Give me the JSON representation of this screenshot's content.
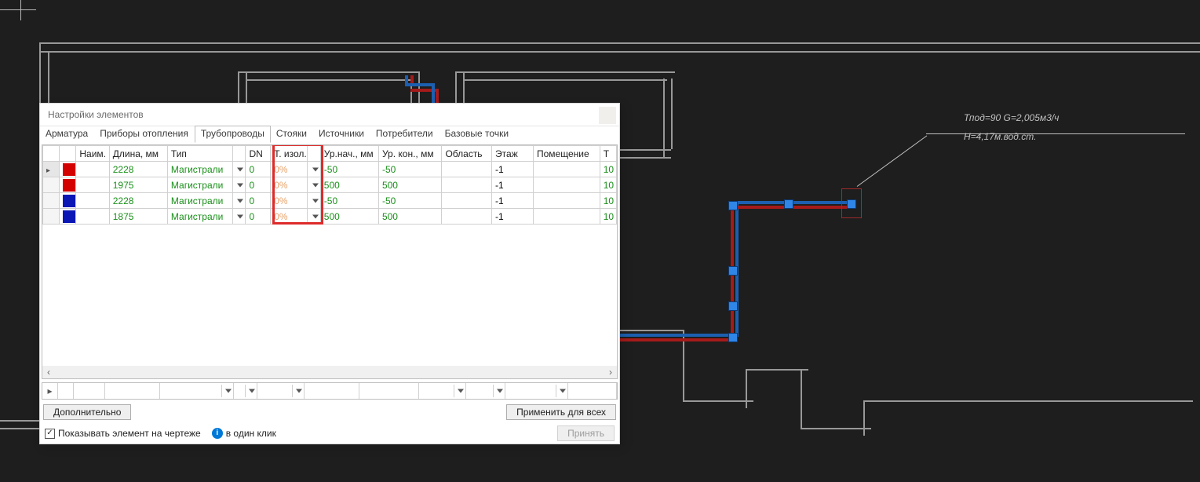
{
  "dialog": {
    "title": "Настройки элементов",
    "tabs": [
      "Арматура",
      "Приборы отопления",
      "Трубопроводы",
      "Стояки",
      "Источники",
      "Потребители",
      "Базовые точки"
    ],
    "activeTab": 2,
    "columns": [
      "",
      "",
      "Наим.",
      "Длина, мм",
      "Тип",
      "",
      "DN",
      "Т. изол.",
      "",
      "Ур.нач., мм",
      "Ур. кон., мм",
      "Область",
      "Этаж",
      "Помещение",
      "Т"
    ],
    "rows": [
      {
        "color": "#d40101",
        "name": "",
        "length": "2228",
        "type": "Магистрали",
        "dn": "0",
        "tizol": "0%",
        "unach": "-50",
        "ukon": "-50",
        "area": "",
        "floor": "-1",
        "room": "",
        "t": "10"
      },
      {
        "color": "#d40101",
        "name": "",
        "length": "1975",
        "type": "Магистрали",
        "dn": "0",
        "tizol": "0%",
        "unach": "500",
        "ukon": "500",
        "area": "",
        "floor": "-1",
        "room": "",
        "t": "10"
      },
      {
        "color": "#0b17b5",
        "name": "",
        "length": "2228",
        "type": "Магистрали",
        "dn": "0",
        "tizol": "0%",
        "unach": "-50",
        "ukon": "-50",
        "area": "",
        "floor": "-1",
        "room": "",
        "t": "10"
      },
      {
        "color": "#0b17b5",
        "name": "",
        "length": "1875",
        "type": "Магистрали",
        "dn": "0",
        "tizol": "0%",
        "unach": "500",
        "ukon": "500",
        "area": "",
        "floor": "-1",
        "room": "",
        "t": "10"
      }
    ],
    "btnExtra": "Дополнительно",
    "btnApplyAll": "Применить для всех",
    "btnAccept": "Принять",
    "checkShowOnDrawing": "Показывать элемент на чертеже",
    "oneClick": "в один клик"
  },
  "annotation": {
    "line1": "Тпод=90 G=2,005м3/ч",
    "line2": "H=4,17м.вод.ст."
  }
}
